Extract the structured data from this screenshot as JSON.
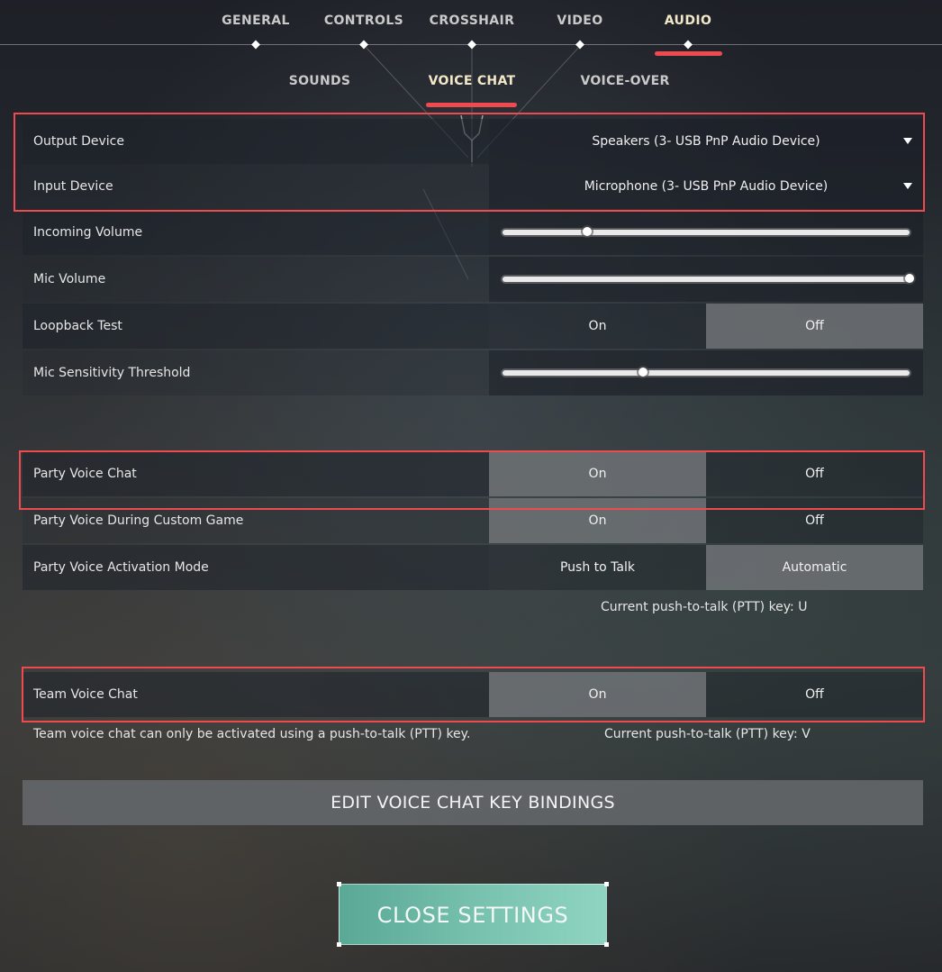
{
  "top_tabs": [
    {
      "label": "GENERAL",
      "active": false
    },
    {
      "label": "CONTROLS",
      "active": false
    },
    {
      "label": "CROSSHAIR",
      "active": false
    },
    {
      "label": "VIDEO",
      "active": false
    },
    {
      "label": "AUDIO",
      "active": true
    }
  ],
  "sub_tabs": [
    {
      "label": "SOUNDS",
      "active": false
    },
    {
      "label": "VOICE CHAT",
      "active": true
    },
    {
      "label": "VOICE-OVER",
      "active": false
    }
  ],
  "devices": {
    "output": {
      "label": "Output Device",
      "value": "Speakers (3- USB PnP Audio Device)"
    },
    "input": {
      "label": "Input Device",
      "value": "Microphone (3- USB PnP Audio Device)"
    }
  },
  "volumes": {
    "incoming": {
      "label": "Incoming Volume",
      "level": 0.2
    },
    "mic": {
      "label": "Mic Volume",
      "level": 1.0
    },
    "sensitivity": {
      "label": "Mic Sensitivity Threshold",
      "level": 0.34
    }
  },
  "loopback": {
    "label": "Loopback Test",
    "on": "On",
    "off": "Off",
    "selected": "off"
  },
  "party": {
    "voice_chat": {
      "label": "Party Voice Chat",
      "on": "On",
      "off": "Off",
      "selected": "on"
    },
    "custom_game": {
      "label": "Party Voice During Custom Game",
      "on": "On",
      "off": "Off",
      "selected": "on"
    },
    "activation": {
      "label": "Party Voice Activation Mode",
      "left": "Push to Talk",
      "right": "Automatic",
      "selected": "right"
    },
    "ptt_note": "Current push-to-talk (PTT) key: U"
  },
  "team": {
    "voice_chat": {
      "label": "Team Voice Chat",
      "on": "On",
      "off": "Off",
      "selected": "on"
    },
    "info": "Team voice chat can only be activated using a push-to-talk (PTT) key.",
    "ptt_note": "Current push-to-talk (PTT) key: V"
  },
  "buttons": {
    "edit_bindings": "EDIT VOICE CHAT KEY BINDINGS",
    "close_settings": "CLOSE SETTINGS"
  },
  "colors": {
    "highlight": "#ef4a4d",
    "active_tab_text": "#f2e8c8",
    "close_button": "#7cc5b2"
  }
}
